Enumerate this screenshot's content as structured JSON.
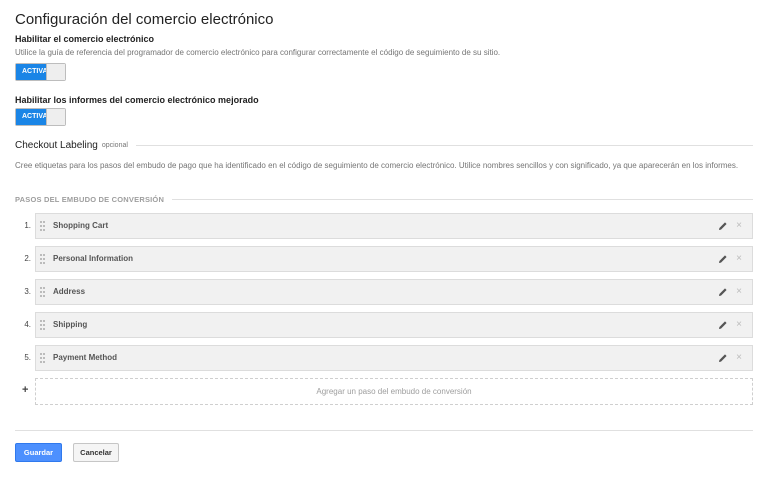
{
  "page_title": "Configuración del comercio electrónico",
  "ecommerce": {
    "heading": "Habilitar el comercio electrónico",
    "help": "Utilice la guía de referencia del programador de comercio electrónico para configurar correctamente el código de seguimiento de su sitio.",
    "toggle_label": "ACTIVA",
    "enabled": true
  },
  "enhanced": {
    "heading": "Habilitar los informes del comercio electrónico mejorado",
    "toggle_label": "ACTIVA",
    "enabled": true
  },
  "checkout": {
    "title": "Checkout Labeling",
    "optional": "opcional",
    "help": "Cree etiquetas para los pasos del embudo de pago que ha identificado en el código de seguimiento de comercio electrónico. Utilice nombres sencillos y con significado, ya que aparecerán en los informes.",
    "funnel_title": "PASOS DEL EMBUDO DE CONVERSIÓN",
    "steps": [
      {
        "num": "1.",
        "name": "Shopping Cart"
      },
      {
        "num": "2.",
        "name": "Personal Information"
      },
      {
        "num": "3.",
        "name": "Address"
      },
      {
        "num": "4.",
        "name": "Shipping"
      },
      {
        "num": "5.",
        "name": "Payment Method"
      }
    ],
    "add_symbol": "+",
    "add_label": "Agregar un paso del embudo de conversión"
  },
  "icons": {
    "drag": "drag-handle-icon",
    "edit": "pencil-icon",
    "remove": "close-icon",
    "remove_glyph": "×"
  },
  "buttons": {
    "save": "Guardar",
    "cancel": "Cancelar"
  },
  "colors": {
    "accent": "#1a85e6",
    "save": "#4d90fe"
  }
}
